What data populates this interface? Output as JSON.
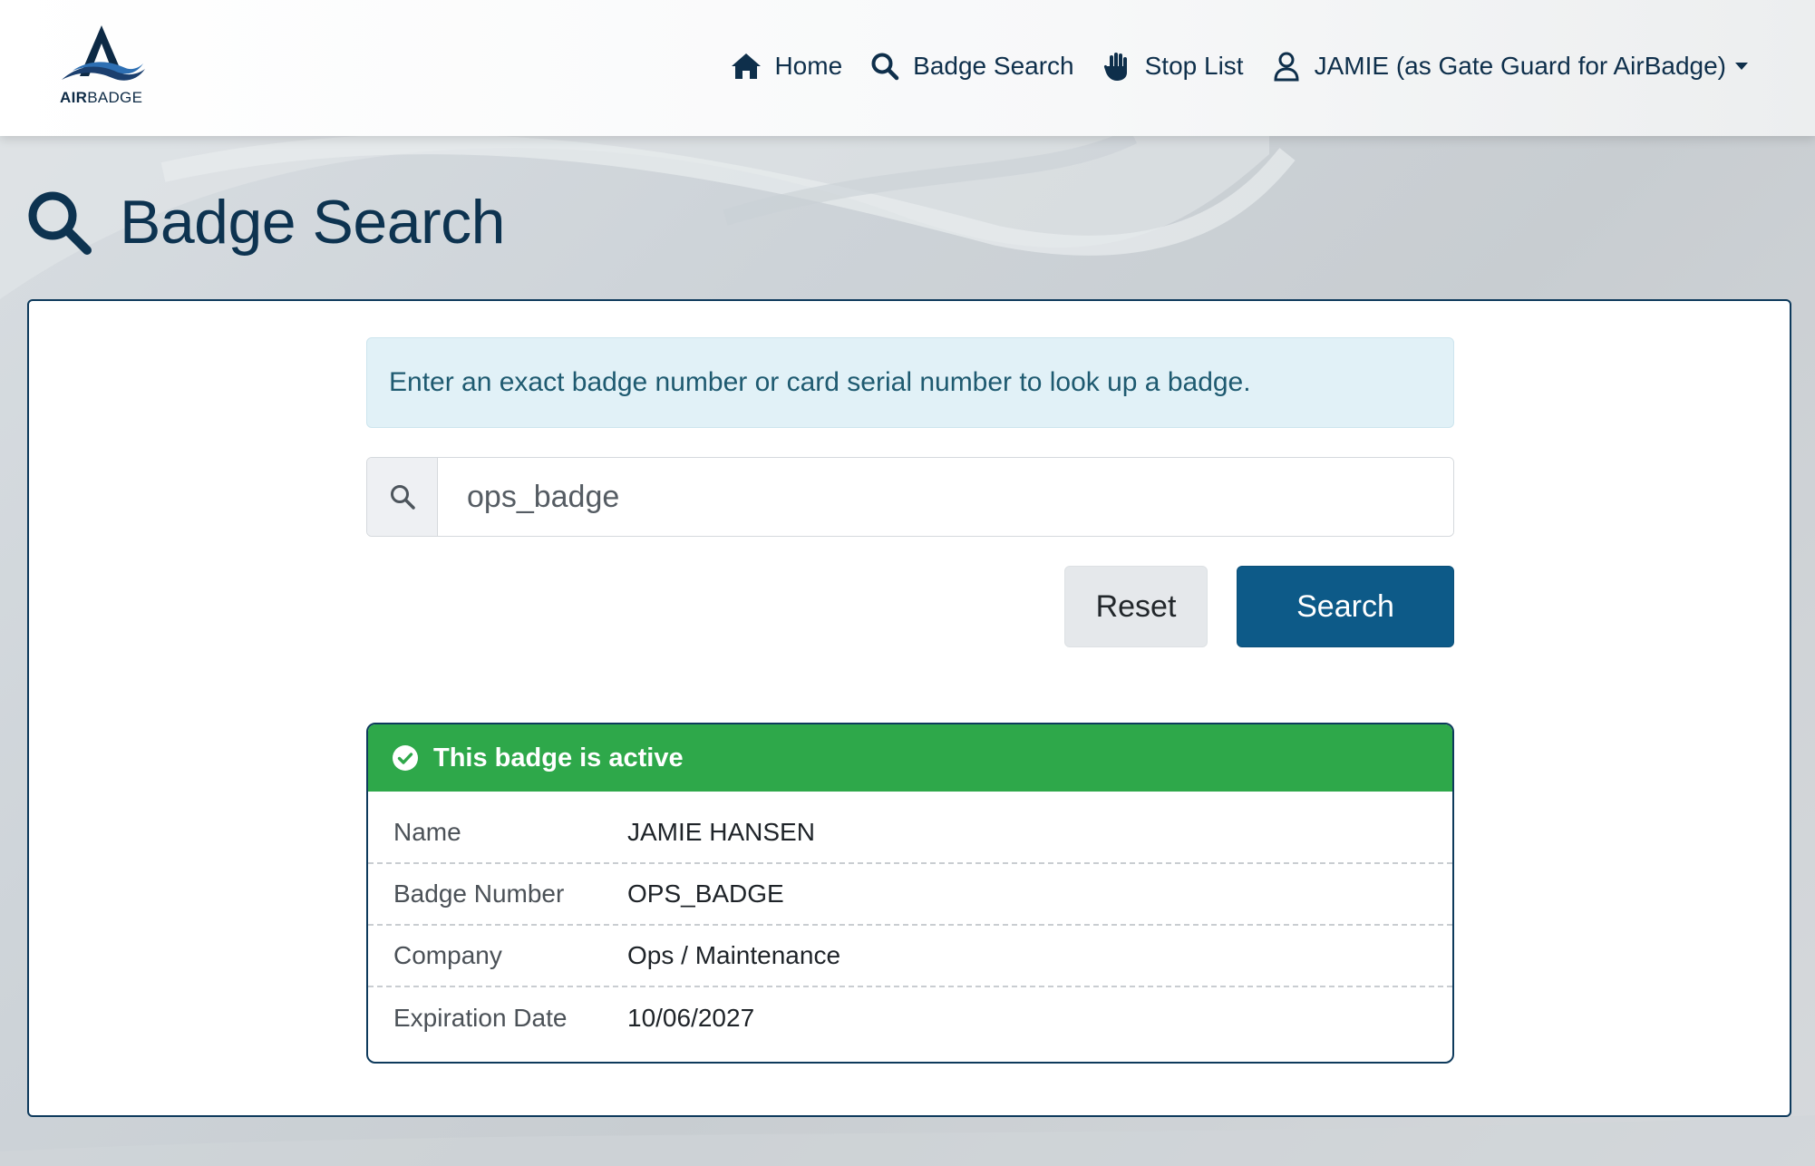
{
  "brand": {
    "name_bold": "AIR",
    "name_rest": "BADGE"
  },
  "nav": {
    "home": "Home",
    "badge_search": "Badge Search",
    "stop_list": "Stop List",
    "user": "JAMIE (as Gate Guard for AirBadge)"
  },
  "page": {
    "title": "Badge Search"
  },
  "alert": {
    "text": "Enter an exact badge number or card serial number to look up a badge."
  },
  "search": {
    "value": "ops_badge"
  },
  "buttons": {
    "reset": "Reset",
    "search": "Search"
  },
  "result": {
    "status": "This badge is active",
    "status_color": "#2ea84a",
    "rows": [
      {
        "label": "Name",
        "value": "JAMIE HANSEN"
      },
      {
        "label": "Badge Number",
        "value": "OPS_BADGE"
      },
      {
        "label": "Company",
        "value": "Ops / Maintenance"
      },
      {
        "label": "Expiration Date",
        "value": "10/06/2027"
      }
    ]
  },
  "colors": {
    "primary": "#0d5a88",
    "navy": "#0e3a5c",
    "info_bg": "#e1f1f7"
  }
}
